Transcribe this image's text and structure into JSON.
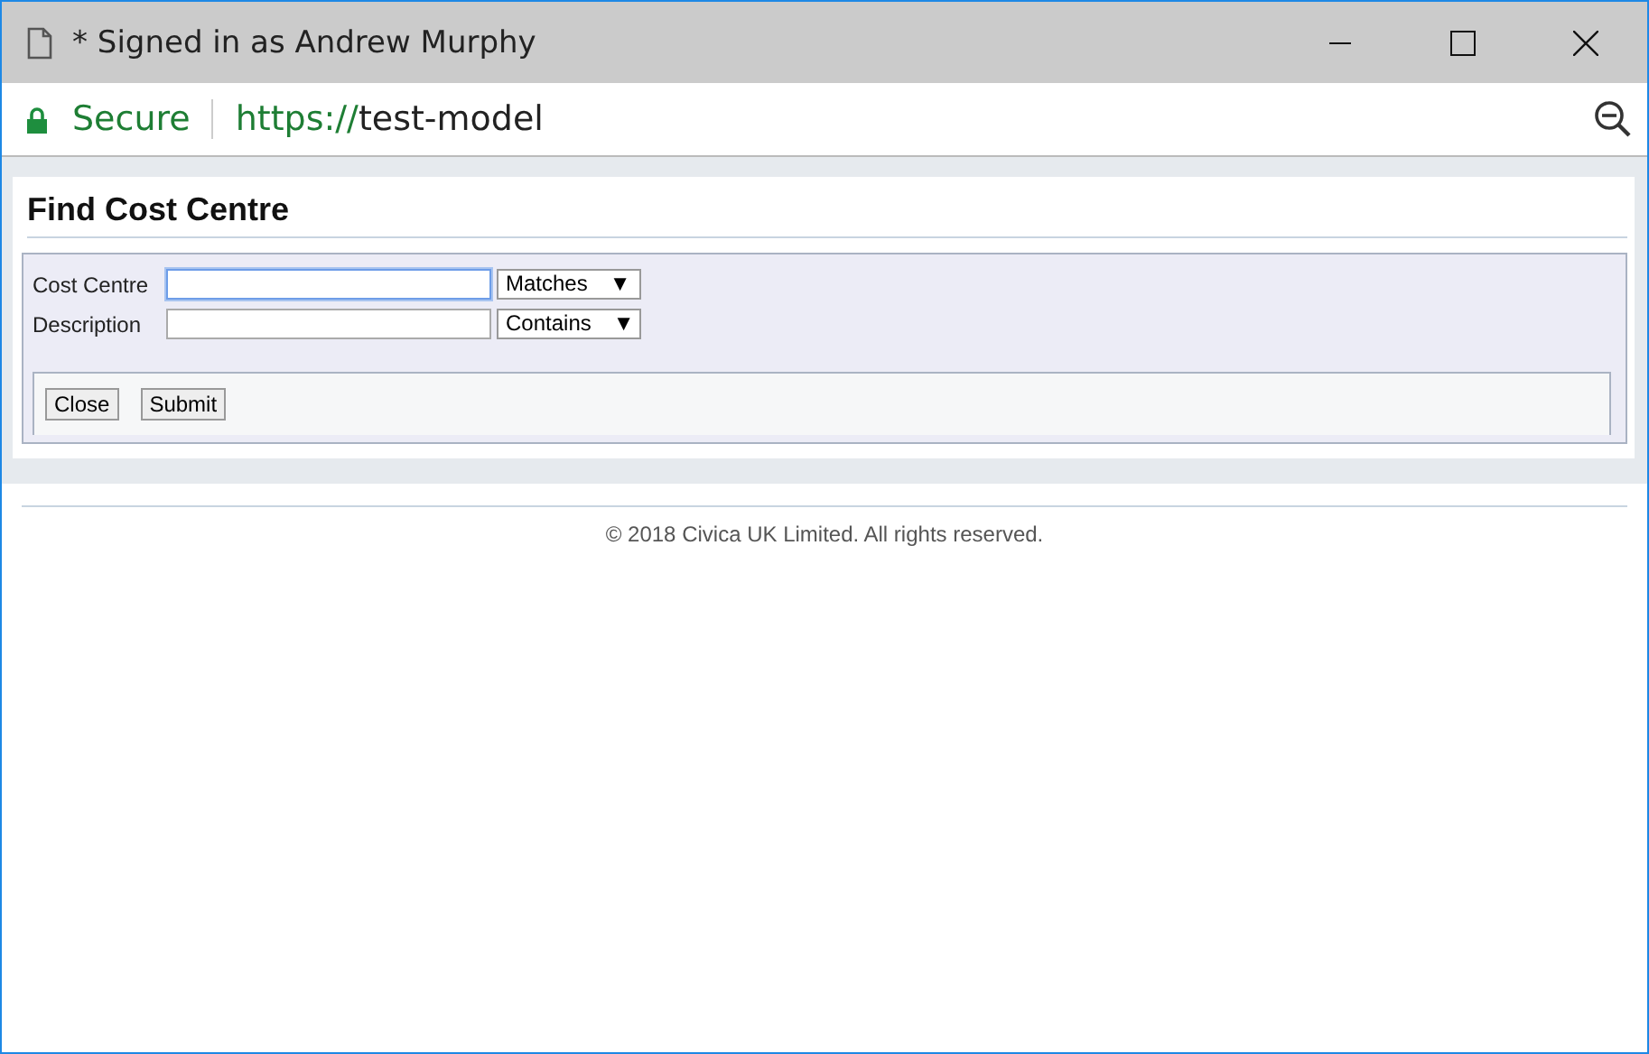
{
  "window": {
    "title": "* Signed in as Andrew Murphy"
  },
  "address_bar": {
    "security": "Secure",
    "scheme": "https://",
    "host": "test-model"
  },
  "panel": {
    "title": "Find Cost Centre",
    "fields": [
      {
        "label": "Cost Centre",
        "focused": true,
        "operator": "Matches",
        "arrow": "▼"
      },
      {
        "label": "Description",
        "focused": false,
        "operator": "Contains",
        "arrow": "▼"
      }
    ],
    "buttons": [
      "Close",
      "Submit"
    ]
  },
  "footer": "© 2018 Civica UK Limited. All rights reserved."
}
